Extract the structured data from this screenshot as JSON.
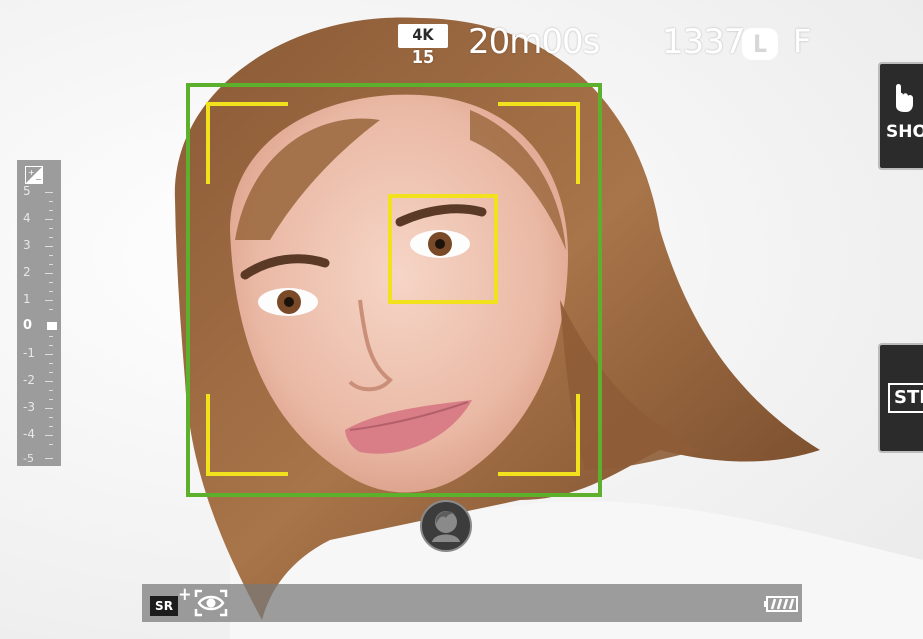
{
  "status_bar": {
    "video_resolution": "4K",
    "frame_rate": "15",
    "recording_time": "20m00s",
    "shots_remaining": "1337",
    "image_size": "L",
    "file_format": "F"
  },
  "exposure_compensation": {
    "labels": [
      "5",
      "4",
      "3",
      "2",
      "1",
      "0",
      "-1",
      "-2",
      "-3",
      "-4",
      "-5"
    ],
    "current": "0"
  },
  "side_buttons": {
    "touch_mode_label": "SHOT",
    "film_simulation_label": "STD"
  },
  "colors": {
    "face_detect_frame": "#5cb02b",
    "focus_frame": "#f2e21e",
    "panel_dark": "#2b2b2b"
  },
  "icons": {
    "exposure": "exposure-compensation-icon",
    "touch": "touch-hand-icon",
    "face_select": "face-select-icon",
    "sr_auto": "sr-auto-icon",
    "eye_af": "eye-af-icon",
    "battery": "battery-icon"
  },
  "bottom_bar": {
    "sr_label": "SR"
  }
}
